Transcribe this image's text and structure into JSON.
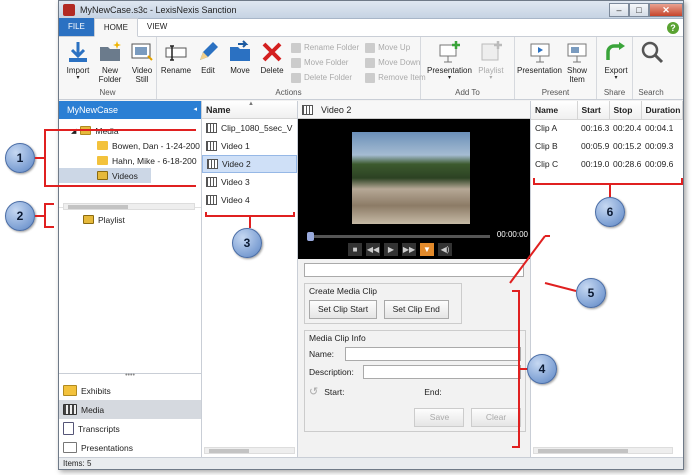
{
  "window": {
    "title": "MyNewCase.s3c - LexisNexis Sanction"
  },
  "tabs": [
    {
      "label": "FILE"
    },
    {
      "label": "HOME"
    },
    {
      "label": "VIEW"
    }
  ],
  "ribbon": {
    "new_group": {
      "name": "New",
      "import": "Import",
      "new_folder": "New\nFolder",
      "video_still": "Video\nStill"
    },
    "actions_group": {
      "name": "Actions",
      "rename": "Rename",
      "edit": "Edit",
      "move": "Move",
      "delete": "Delete",
      "rename_folder": "Rename Folder",
      "move_folder": "Move Folder",
      "delete_folder": "Delete Folder",
      "move_up": "Move Up",
      "move_down": "Move Down",
      "remove_item": "Remove Item"
    },
    "addto_group": {
      "name": "Add To",
      "presentation": "Presentation",
      "playlist": "Playlist"
    },
    "present_group": {
      "name": "Present",
      "presentation": "Presentation",
      "show_item": "Show\nItem"
    },
    "share_group": {
      "name": "Share",
      "export": "Export"
    },
    "search_group": {
      "name": "Search"
    }
  },
  "nav": {
    "case_name": "MyNewCase",
    "tree": [
      {
        "label": "Media"
      },
      {
        "label": "Bowen, Dan - 1-24-200"
      },
      {
        "label": "Hahn, Mike - 6-18-200"
      },
      {
        "label": "Videos"
      }
    ],
    "playlist": "Playlist",
    "bottom": [
      {
        "label": "Exhibits"
      },
      {
        "label": "Media"
      },
      {
        "label": "Transcripts"
      },
      {
        "label": "Presentations"
      }
    ]
  },
  "files": {
    "column": "Name",
    "rows": [
      {
        "label": "Clip_1080_5sec_V"
      },
      {
        "label": "Video 1"
      },
      {
        "label": "Video 2"
      },
      {
        "label": "Video 3"
      },
      {
        "label": "Video 4"
      }
    ]
  },
  "viewer": {
    "title": "Video 2",
    "time": "00:00:00"
  },
  "create_clip": {
    "legend": "Create Media Clip",
    "start": "Set Clip Start",
    "end": "Set Clip End"
  },
  "clip_info": {
    "legend": "Media Clip Info",
    "name": "Name:",
    "description": "Description:",
    "start": "Start:",
    "end": "End:",
    "save": "Save",
    "clear": "Clear"
  },
  "clips": {
    "columns": [
      "Name",
      "Start",
      "Stop",
      "Duration"
    ],
    "rows": [
      [
        "Clip A",
        "00:16.3",
        "00:20.4",
        "00:04.1"
      ],
      [
        "Clip B",
        "00:05.9",
        "00:15.2",
        "00:09.3"
      ],
      [
        "Clip C",
        "00:19.0",
        "00:28.6",
        "00:09.6"
      ]
    ]
  },
  "status": "Items: 5",
  "callouts": [
    "1",
    "2",
    "3",
    "4",
    "5",
    "6"
  ],
  "colors": {
    "accent": "#2b7fd4",
    "callout_border": "#e02020",
    "file_tab": "#2b71c2"
  }
}
